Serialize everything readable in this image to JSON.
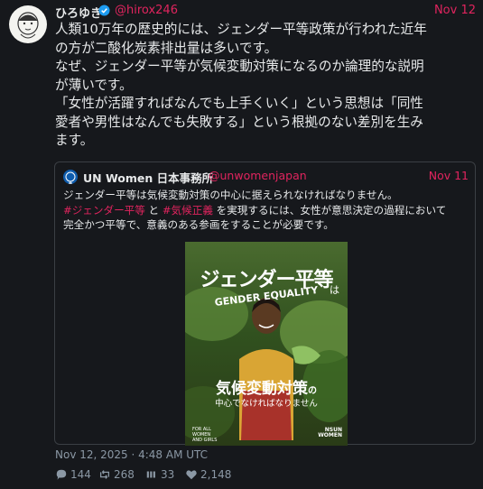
{
  "author": {
    "name": "ひろゆき",
    "handle": "@hirox246",
    "date": "Nov 12",
    "verified_icon": "verified-badge-icon"
  },
  "tweet": {
    "text": "人類10万年の歴史的には、ジェンダー平等政策が行われた近年\nの方が二酸化炭素排出量は多いです。\nなぜ、ジェンダー平等が気候変動対策になるのか論理的な説明\nが薄いです。\n「女性が活躍すればなんでも上手くいく」という思想は「同性\n愛者や男性はなんでも失敗する」という根拠のない差別を生み\nます。"
  },
  "quote": {
    "name": "UN Women 日本事務所",
    "handle": "@unwomenjapan",
    "date": "Nov 11",
    "line1": "ジェンダー平等は気候変動対策の中心に据えられなければなりません。",
    "hashtag1": "#ジェンダー平等",
    "connector": " と ",
    "hashtag2": "#気候正義",
    "line2_rest": " を実現するには、女性が意思決定の過程において",
    "line3": "完全かつ平等で、意義のある参画をすることが必要です。",
    "poster": {
      "title": "ジェンダー平等",
      "title_particle": "は",
      "subtitle_en": "GENDER EQUALITY",
      "headline": "気候変動対策",
      "headline_particle": "の",
      "subline": "中心でなければなりません",
      "footer_left": "FOR ALL\nWOMEN\nAND GIRLS",
      "footer_right": "NSUN\nWOMEN"
    }
  },
  "timestamp": "Nov 12, 2025 · 4:48 AM UTC",
  "stats": {
    "replies": "144",
    "retweets": "268",
    "quotes": "33",
    "likes": "2,148"
  },
  "colors": {
    "accent": "#e0245e",
    "background": "#16181c",
    "text": "#e7e9ea",
    "muted": "#8b98a5",
    "verified": "#1d9bf0"
  }
}
